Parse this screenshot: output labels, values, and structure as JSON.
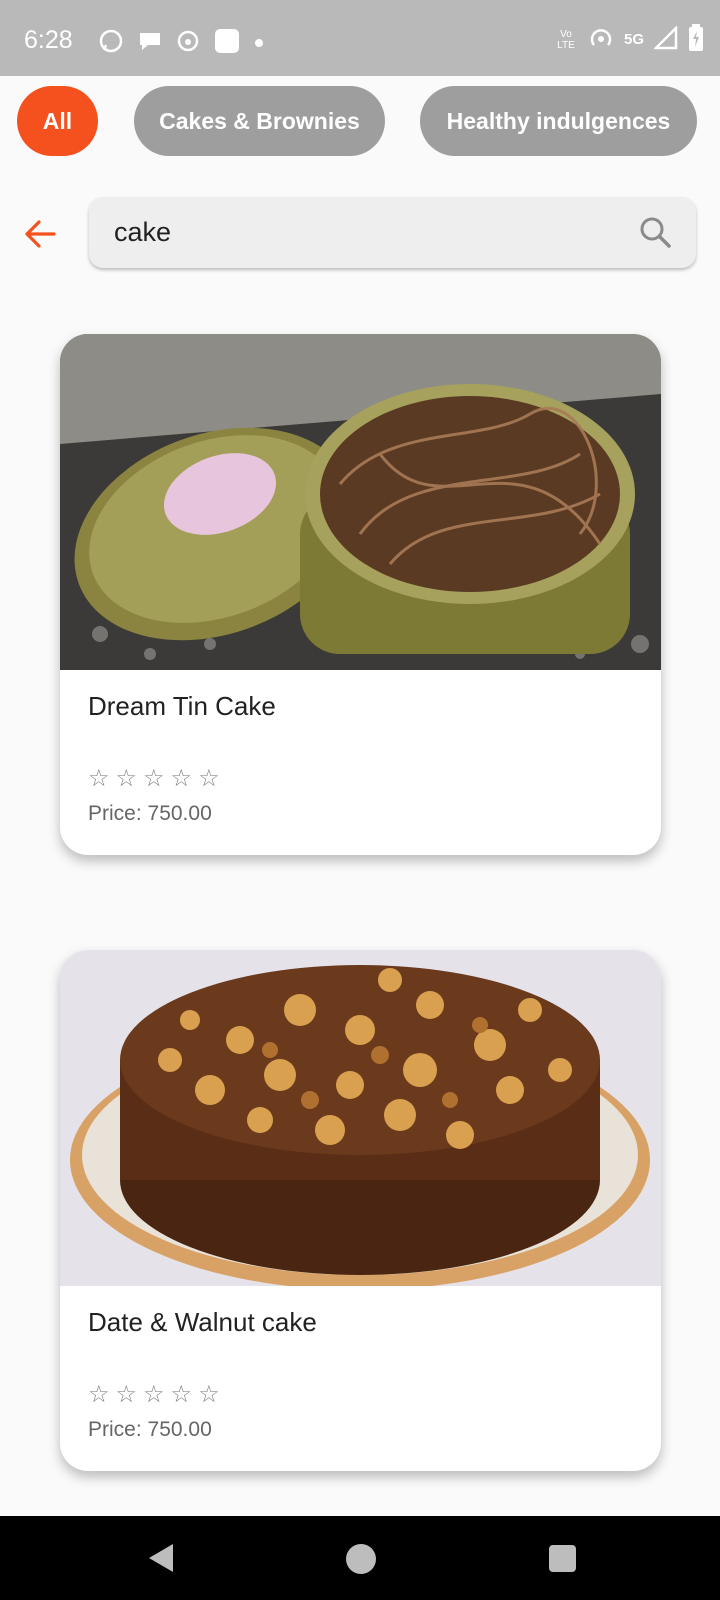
{
  "status_bar": {
    "time": "6:28",
    "network": "5G",
    "volte": "Vo LTE"
  },
  "categories": [
    {
      "label": "All",
      "active": true
    },
    {
      "label": "Cakes & Brownies",
      "active": false
    },
    {
      "label": "Healthy indulgences",
      "active": false
    }
  ],
  "search": {
    "value": "cake"
  },
  "products": [
    {
      "title": "Dream Tin Cake",
      "rating": 0,
      "price": "Price: 750.00",
      "image": "chocolate-tin-cake-photo"
    },
    {
      "title": "Date & Walnut cake",
      "rating": 0,
      "price": "Price: 750.00",
      "image": "walnut-cake-photo"
    }
  ],
  "colors": {
    "accent": "#f4511e",
    "chip_inactive": "#9e9e9e",
    "status_bar": "#b9b9b9"
  }
}
